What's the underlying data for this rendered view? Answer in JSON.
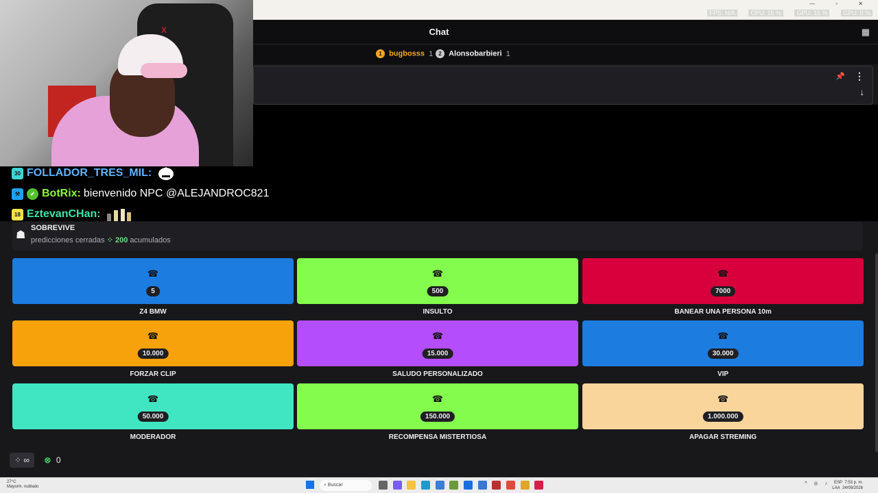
{
  "browser": {
    "window_controls": "— ▫ ✕",
    "stats": [
      "FPS: N/A",
      "CPU: 15 %",
      "GPU: 15 %",
      "GPU: 0 %"
    ]
  },
  "chat": {
    "title": "Chat",
    "leaderboard": [
      {
        "rank": "1",
        "name": "bugbosss",
        "count": "1",
        "color": "#f6a623",
        "text_color": "#f6a623"
      },
      {
        "rank": "2",
        "name": "Alonsobarbieri",
        "count": "1",
        "color": "#c9c9c9",
        "text_color": "#efeff1"
      }
    ]
  },
  "overlay_messages": [
    {
      "badge": "30",
      "badge_color": "#3fd4d4",
      "user": "FOLLADOR_TRES_MIL:",
      "user_color": "#5fb3ff",
      "text": ""
    },
    {
      "badge": "",
      "badge_color": "#1da1f2",
      "user": "BotRix:",
      "user_color": "#8ef542",
      "text": "bienvenido NPC @ALEJANDROC821"
    },
    {
      "badge": "18",
      "badge_color": "#f2e24a",
      "user": "EztevanCHan:",
      "user_color": "#3ee6a8",
      "text": ""
    }
  ],
  "prediction": {
    "title": "SOBREVIVE",
    "status": "predicciones cerradas",
    "points": "200",
    "suffix": "acumulados"
  },
  "rewards": [
    {
      "cost": "5",
      "label": "Z4 BMW",
      "color": "#1d7ce0"
    },
    {
      "cost": "500",
      "label": "INSULTO",
      "color": "#84fc4d"
    },
    {
      "cost": "7000",
      "label": "BANEAR UNA PERSONA 10m",
      "color": "#d7003c"
    },
    {
      "cost": "10.000",
      "label": "FORZAR CLIP",
      "color": "#f7a20a"
    },
    {
      "cost": "15.000",
      "label": "SALUDO PERSONALIZADO",
      "color": "#b44dfb"
    },
    {
      "cost": "30.000",
      "label": "VIP",
      "color": "#1d7ce0"
    },
    {
      "cost": "50.000",
      "label": "MODERADOR",
      "color": "#40e6c2"
    },
    {
      "cost": "150.000",
      "label": "RECOMPENSA MISTERTIOSA",
      "color": "#84fc4d"
    },
    {
      "cost": "1.000.000",
      "label": "APAGAR STREMING",
      "color": "#fad59b"
    }
  ],
  "balance": {
    "points_label": "∞",
    "x_count": "0"
  },
  "taskbar": {
    "temp": "27°C",
    "weather": "Mayorm. nublado",
    "search_placeholder": "Buscar",
    "lang": "ESP",
    "lang2": "LAA",
    "time": "7:53 p. m.",
    "date": "24/08/2026"
  }
}
